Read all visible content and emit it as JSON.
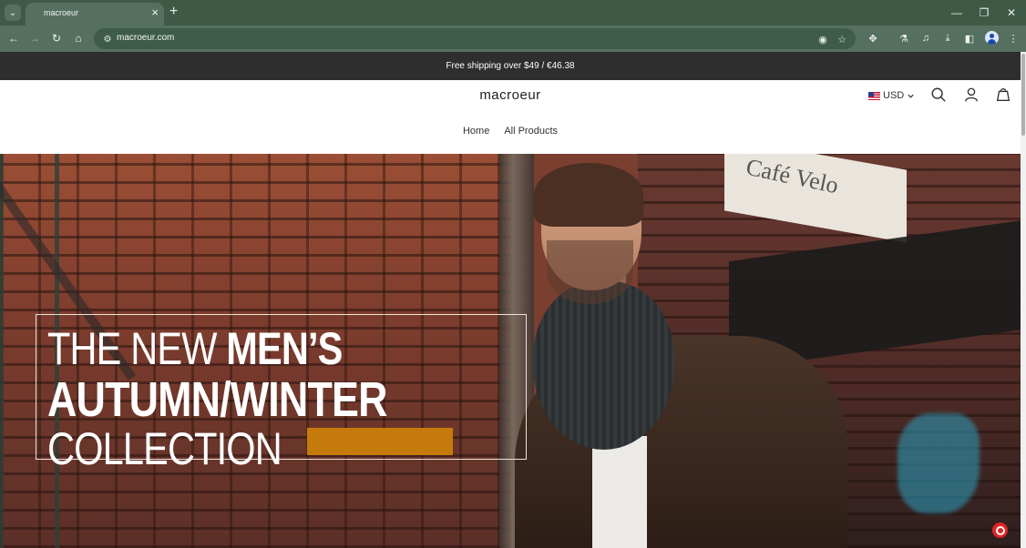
{
  "browser": {
    "tab_title": "macroeur",
    "url": "macroeur.com",
    "icons": {
      "tab_menu": "chevron-down-icon",
      "tab_close": "close-icon",
      "new_tab": "plus-icon",
      "minimize": "minimize-icon",
      "restore": "restore-icon",
      "close_window": "close-icon",
      "back": "arrow-left-icon",
      "forward": "arrow-right-icon",
      "reload": "reload-icon",
      "home": "home-icon",
      "site_info": "tune-icon",
      "eye_off": "eye-off-icon",
      "bookmark": "star-icon",
      "extensions": "puzzle-icon",
      "labs": "flask-icon",
      "media": "media-icon",
      "downloads": "download-icon",
      "side_panel": "side-panel-icon",
      "profile": "avatar-icon",
      "menu": "more-vertical-icon"
    },
    "colors": {
      "tabbar": "#3e5a47",
      "toolbar": "#557060"
    }
  },
  "page": {
    "announcement": "Free shipping over $49 / €46.38",
    "logo": "macroeur",
    "currency": "USD",
    "nav": [
      {
        "label": "Home"
      },
      {
        "label": "All Products"
      }
    ],
    "header_icons": [
      "search-icon",
      "account-icon",
      "cart-icon"
    ],
    "hero": {
      "line1_light": "THE NEW ",
      "line1_bold": "MEN’S",
      "line2": "AUTUMN/WINTER",
      "line3": "COLLECTION",
      "sign_text": "Café Velo"
    },
    "colors": {
      "announcement_bg": "#2e2e2e",
      "cta": "#c57a0c"
    }
  }
}
